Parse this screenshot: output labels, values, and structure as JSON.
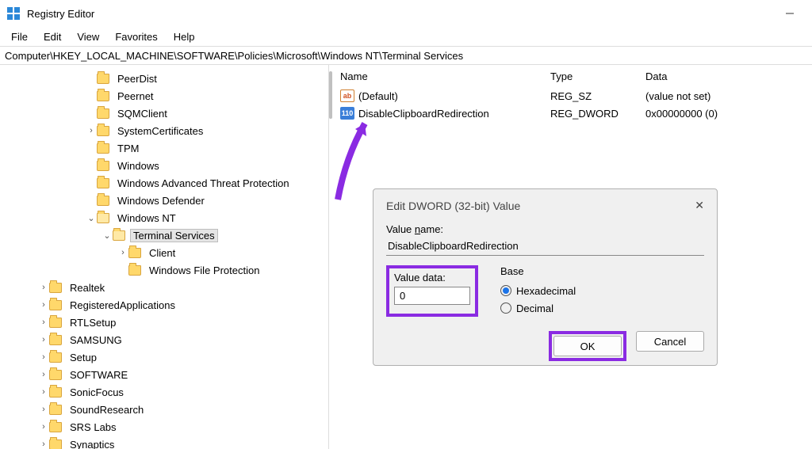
{
  "window": {
    "title": "Registry Editor"
  },
  "menu": {
    "file": "File",
    "edit": "Edit",
    "view": "View",
    "favorites": "Favorites",
    "help": "Help"
  },
  "addressbar": "Computer\\HKEY_LOCAL_MACHINE\\SOFTWARE\\Policies\\Microsoft\\Windows NT\\Terminal Services",
  "tree": {
    "items": [
      {
        "indent": 108,
        "chev": "",
        "label": "PeerDist"
      },
      {
        "indent": 108,
        "chev": "",
        "label": "Peernet"
      },
      {
        "indent": 108,
        "chev": "",
        "label": "SQMClient"
      },
      {
        "indent": 108,
        "chev": ">",
        "label": "SystemCertificates"
      },
      {
        "indent": 108,
        "chev": "",
        "label": "TPM"
      },
      {
        "indent": 108,
        "chev": "",
        "label": "Windows"
      },
      {
        "indent": 108,
        "chev": "",
        "label": "Windows Advanced Threat Protection"
      },
      {
        "indent": 108,
        "chev": "",
        "label": "Windows Defender"
      },
      {
        "indent": 108,
        "chev": "v",
        "label": "Windows NT",
        "open": true
      },
      {
        "indent": 128,
        "chev": "v",
        "label": "Terminal Services",
        "open": true,
        "sel": true
      },
      {
        "indent": 148,
        "chev": ">",
        "label": "Client"
      },
      {
        "indent": 148,
        "chev": "",
        "label": "Windows File Protection"
      },
      {
        "indent": 48,
        "chev": ">",
        "label": "Realtek"
      },
      {
        "indent": 48,
        "chev": ">",
        "label": "RegisteredApplications"
      },
      {
        "indent": 48,
        "chev": ">",
        "label": "RTLSetup"
      },
      {
        "indent": 48,
        "chev": ">",
        "label": "SAMSUNG"
      },
      {
        "indent": 48,
        "chev": ">",
        "label": "Setup"
      },
      {
        "indent": 48,
        "chev": ">",
        "label": "SOFTWARE"
      },
      {
        "indent": 48,
        "chev": ">",
        "label": "SonicFocus"
      },
      {
        "indent": 48,
        "chev": ">",
        "label": "SoundResearch"
      },
      {
        "indent": 48,
        "chev": ">",
        "label": "SRS Labs"
      },
      {
        "indent": 48,
        "chev": ">",
        "label": "Synaptics"
      }
    ]
  },
  "list": {
    "headers": {
      "name": "Name",
      "type": "Type",
      "data": "Data"
    },
    "rows": [
      {
        "icon": "ab",
        "name": "(Default)",
        "type": "REG_SZ",
        "data": "(value not set)"
      },
      {
        "icon": "dw",
        "name": "DisableClipboardRedirection",
        "type": "REG_DWORD",
        "data": "0x00000000 (0)"
      }
    ]
  },
  "dialog": {
    "title": "Edit DWORD (32-bit) Value",
    "value_name_label": "Value name:",
    "value_name_u": "n",
    "value_name": "DisableClipboardRedirection",
    "value_data_label": "Value data:",
    "value_data_u": "V",
    "value_data": "0",
    "base_label": "Base",
    "hex_label": "Hexadecimal",
    "hex_u": "H",
    "dec_label": "Decimal",
    "dec_u": "D",
    "ok": "OK",
    "cancel": "Cancel"
  }
}
